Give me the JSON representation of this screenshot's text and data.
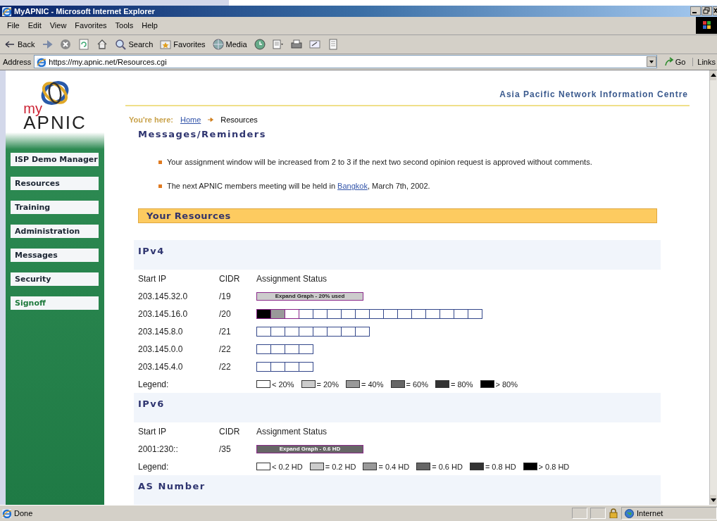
{
  "window": {
    "title": "MyAPNIC - Microsoft Internet Explorer"
  },
  "menu": [
    "File",
    "Edit",
    "View",
    "Favorites",
    "Tools",
    "Help"
  ],
  "toolbar": [
    {
      "kind": "back",
      "label": "Back"
    },
    {
      "kind": "forward"
    },
    {
      "kind": "stop"
    },
    {
      "kind": "refresh"
    },
    {
      "kind": "home"
    },
    {
      "kind": "search",
      "label": "Search"
    },
    {
      "kind": "favorites",
      "label": "Favorites"
    },
    {
      "kind": "media",
      "label": "Media"
    },
    {
      "kind": "history"
    },
    {
      "kind": "mail"
    },
    {
      "kind": "print"
    },
    {
      "kind": "edit"
    },
    {
      "kind": "discuss"
    }
  ],
  "address": {
    "label": "Address",
    "value": "https://my.apnic.net/Resources.cgi",
    "go": "Go",
    "links": "Links"
  },
  "logo": {
    "prefix": "my",
    "name": "APNIC"
  },
  "sidebar": {
    "items": [
      {
        "label": "ISP Demo Manager",
        "color": "#1c2633"
      },
      {
        "label": "Resources",
        "color": "#1c2633"
      },
      {
        "label": "Training",
        "color": "#1c2633"
      },
      {
        "label": "Administration",
        "color": "#1c2633"
      },
      {
        "label": "Messages",
        "color": "#1c2633"
      },
      {
        "label": "Security",
        "color": "#1c2633"
      },
      {
        "label": "Signoff",
        "color": "#1e7a3c"
      }
    ]
  },
  "header": {
    "org": "Asia Pacific Network Information Centre"
  },
  "breadcrumb": {
    "label": "You're here:",
    "items": [
      {
        "label": "Home",
        "link": true
      },
      {
        "label": "Resources",
        "link": false
      }
    ]
  },
  "messages": {
    "title": "Messages/Reminders",
    "items": [
      {
        "text": "Your assignment window will be increased from 2 to 3 if the next two second opinion request is approved without comments."
      },
      {
        "text": "The next APNIC members meeting will be held in ",
        "link": "Bangkok",
        "after": ", March 7th, 2002."
      }
    ]
  },
  "resources": {
    "title": "Your Resources",
    "sections": [
      {
        "title": "IPv4",
        "columns": [
          "Start IP",
          "CIDR",
          "Assignment Status"
        ],
        "rows": [
          {
            "start_ip": "203.145.32.0",
            "cidr": "/19",
            "status": {
              "kind": "graph",
              "label": "Expand Graph - 20% used",
              "color": "#cccccc"
            }
          },
          {
            "start_ip": "203.145.16.0",
            "cidr": "/20",
            "status": {
              "kind": "blocks",
              "blocks": [
                {
                  "color": "#000000",
                  "allocated": true
                },
                {
                  "color": "#999999",
                  "allocated": true
                },
                {
                  "color": "#ffffff",
                  "allocated": true
                },
                {
                  "color": "#ffffff",
                  "allocated": false
                },
                {
                  "color": "#ffffff",
                  "allocated": false
                },
                {
                  "color": "#ffffff",
                  "allocated": false
                },
                {
                  "color": "#ffffff",
                  "allocated": false
                },
                {
                  "color": "#ffffff",
                  "allocated": false
                },
                {
                  "color": "#ffffff",
                  "allocated": false
                },
                {
                  "color": "#ffffff",
                  "allocated": false
                },
                {
                  "color": "#ffffff",
                  "allocated": false
                },
                {
                  "color": "#ffffff",
                  "allocated": false
                },
                {
                  "color": "#ffffff",
                  "allocated": false
                },
                {
                  "color": "#ffffff",
                  "allocated": false
                },
                {
                  "color": "#ffffff",
                  "allocated": false
                },
                {
                  "color": "#ffffff",
                  "allocated": false
                }
              ]
            }
          },
          {
            "start_ip": "203.145.8.0",
            "cidr": "/21",
            "status": {
              "kind": "blocks",
              "blocks": [
                {
                  "color": "#ffffff",
                  "allocated": false
                },
                {
                  "color": "#ffffff",
                  "allocated": false
                },
                {
                  "color": "#ffffff",
                  "allocated": false
                },
                {
                  "color": "#ffffff",
                  "allocated": false
                },
                {
                  "color": "#ffffff",
                  "allocated": false
                },
                {
                  "color": "#ffffff",
                  "allocated": false
                },
                {
                  "color": "#ffffff",
                  "allocated": false
                },
                {
                  "color": "#ffffff",
                  "allocated": false
                }
              ]
            }
          },
          {
            "start_ip": "203.145.0.0",
            "cidr": "/22",
            "status": {
              "kind": "blocks",
              "blocks": [
                {
                  "color": "#ffffff",
                  "allocated": false
                },
                {
                  "color": "#ffffff",
                  "allocated": false
                },
                {
                  "color": "#ffffff",
                  "allocated": false
                },
                {
                  "color": "#ffffff",
                  "allocated": false
                }
              ]
            }
          },
          {
            "start_ip": "203.145.4.0",
            "cidr": "/22",
            "status": {
              "kind": "blocks",
              "blocks": [
                {
                  "color": "#ffffff",
                  "allocated": false
                },
                {
                  "color": "#ffffff",
                  "allocated": false
                },
                {
                  "color": "#ffffff",
                  "allocated": false
                },
                {
                  "color": "#ffffff",
                  "allocated": false
                }
              ]
            }
          }
        ],
        "legend": {
          "label": "Legend:",
          "items": [
            {
              "label": "< 20%",
              "color": "#ffffff"
            },
            {
              "label": "= 20%",
              "color": "#cccccc"
            },
            {
              "label": "= 40%",
              "color": "#999999"
            },
            {
              "label": "= 60%",
              "color": "#666666"
            },
            {
              "label": "= 80%",
              "color": "#333333"
            },
            {
              "label": "> 80%",
              "color": "#000000"
            }
          ]
        }
      },
      {
        "title": "IPv6",
        "columns": [
          "Start IP",
          "CIDR",
          "Assignment Status"
        ],
        "rows": [
          {
            "start_ip": "2001:230::",
            "cidr": "/35",
            "status": {
              "kind": "graph",
              "label": "Expand Graph - 0.6 HD",
              "color": "#666666"
            }
          }
        ],
        "legend": {
          "label": "Legend:",
          "items": [
            {
              "label": "< 0.2 HD",
              "color": "#ffffff"
            },
            {
              "label": "= 0.2 HD",
              "color": "#cccccc"
            },
            {
              "label": "= 0.4 HD",
              "color": "#999999"
            },
            {
              "label": "= 0.6 HD",
              "color": "#666666"
            },
            {
              "label": "= 0.8 HD",
              "color": "#333333"
            },
            {
              "label": "> 0.8 HD",
              "color": "#000000"
            }
          ]
        }
      },
      {
        "title": "AS Number"
      }
    ]
  },
  "status_bar": {
    "text": "Done",
    "zone": "Internet"
  }
}
